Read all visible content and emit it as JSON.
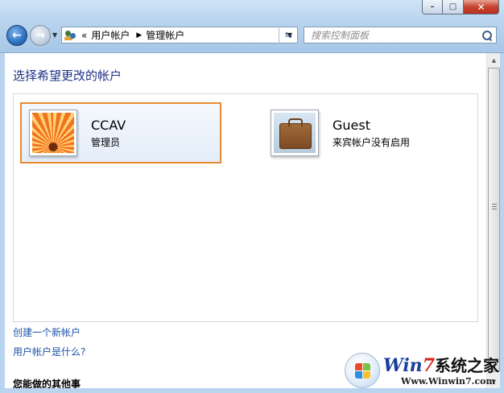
{
  "window": {
    "minimize_glyph": "–",
    "maximize_glyph": "□",
    "close_glyph": "✕"
  },
  "address": {
    "prefix": "«",
    "segments": [
      "用户帐户",
      "管理帐户"
    ]
  },
  "search": {
    "placeholder": "搜索控制面板"
  },
  "main": {
    "title": "选择希望更改的帐户",
    "accounts": [
      {
        "name": "CCAV",
        "role": "管理员",
        "selected": true,
        "icon": "orange-flower-icon"
      },
      {
        "name": "Guest",
        "role": "来宾帐户没有启用",
        "selected": false,
        "icon": "suitcase-icon"
      }
    ],
    "links": [
      "创建一个新帐户",
      "用户帐户是什么?"
    ],
    "other_heading": "您能做的其他事"
  },
  "watermark": {
    "brand_win": "Win",
    "brand_seven": "7",
    "brand_rest": "系统之家",
    "url": "Www.Winwin7.com"
  },
  "colors": {
    "selection_border": "#e88b30",
    "title_blue": "#1e3287",
    "link_blue": "#1f53a8"
  }
}
